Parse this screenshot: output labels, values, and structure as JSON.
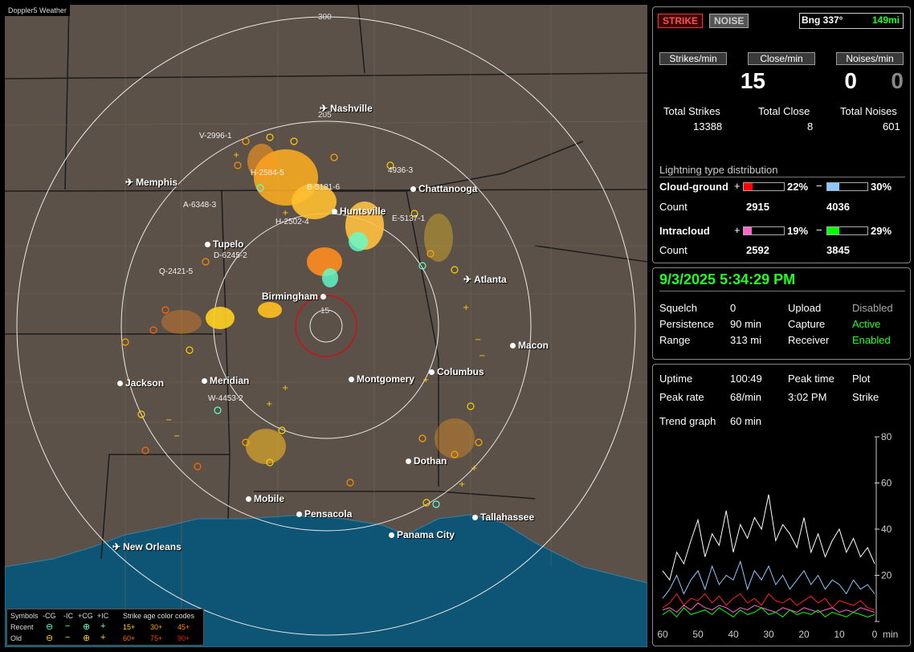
{
  "app": {
    "title": "Doppler5 Weather"
  },
  "map": {
    "range_labels": [
      "300",
      "205",
      "15"
    ],
    "cities": [
      {
        "name": "Nashville",
        "type": "airport"
      },
      {
        "name": "Memphis",
        "type": "airport"
      },
      {
        "name": "Chattanooga",
        "type": "city"
      },
      {
        "name": "Huntsville",
        "type": "city"
      },
      {
        "name": "Tupelo",
        "type": "city"
      },
      {
        "name": "Atlanta",
        "type": "airport"
      },
      {
        "name": "Birmingham",
        "type": "city"
      },
      {
        "name": "Macon",
        "type": "city"
      },
      {
        "name": "Jackson",
        "type": "city"
      },
      {
        "name": "Meridian",
        "type": "city"
      },
      {
        "name": "Montgomery",
        "type": "city"
      },
      {
        "name": "Columbus",
        "type": "city"
      },
      {
        "name": "Dothan",
        "type": "city"
      },
      {
        "name": "Mobile",
        "type": "city"
      },
      {
        "name": "Pensacola",
        "type": "city"
      },
      {
        "name": "Tallahassee",
        "type": "city"
      },
      {
        "name": "Panama City",
        "type": "city"
      },
      {
        "name": "New Orleans",
        "type": "airport"
      }
    ],
    "storm_labels": [
      "V-2996-1",
      "H-2584-5",
      "B-5181-6",
      "4936-3",
      "A-6348-3",
      "H-2502-4",
      "E-5137-1",
      "D-6245-2",
      "Q-2421-5",
      "W-4453-2"
    ]
  },
  "legend": {
    "symbols_label": "Symbols",
    "headers": [
      "-CG",
      "-IC",
      "+CG",
      "+IC"
    ],
    "recent_label": "Recent",
    "old_label": "Old",
    "age_title": "Strike age color codes",
    "recent_ages": [
      "15+",
      "30+",
      "45+"
    ],
    "old_ages": [
      "60+",
      "75+",
      "90+"
    ],
    "age_colors": [
      "#ffd700",
      "#ffa500",
      "#ff8c00",
      "#ff6a00",
      "#ff4500",
      "#e02000"
    ]
  },
  "status": {
    "strike_label": "STRIKE",
    "noise_label": "NOISE",
    "bearing": "Bng 337°",
    "distance": "149mi",
    "strikes_per_min_label": "Strikes/min",
    "close_per_min_label": "Close/min",
    "noises_per_min_label": "Noises/min",
    "strikes_per_min": "15",
    "close_per_min": "0",
    "noises_per_min": "0",
    "total_strikes_label": "Total Strikes",
    "total_close_label": "Total Close",
    "total_noises_label": "Total Noises",
    "total_strikes": "13388",
    "total_close": "8",
    "total_noises": "601",
    "dist_title": "Lightning type distribution",
    "cg_label": "Cloud-ground",
    "ic_label": "Intracloud",
    "count_label": "Count",
    "plus": "+",
    "minus": "−",
    "cg_pos_pct": "22%",
    "cg_neg_pct": "30%",
    "cg_pos_count": "2915",
    "cg_neg_count": "4036",
    "ic_pos_pct": "19%",
    "ic_neg_pct": "29%",
    "ic_pos_count": "2592",
    "ic_neg_count": "3845",
    "bar_levels": {
      "cg_pos": 0.22,
      "cg_neg": 0.3,
      "ic_pos": 0.19,
      "ic_neg": 0.29
    },
    "bar_colors": {
      "cg_pos": "#ff0000",
      "cg_neg": "#8ec8ff",
      "ic_pos": "#ff66cc",
      "ic_neg": "#00ff00"
    }
  },
  "settings": {
    "datetime": "9/3/2025 5:34:29 PM",
    "squelch_label": "Squelch",
    "squelch": "0",
    "persistence_label": "Persistence",
    "persistence": "90 min",
    "range_label": "Range",
    "range": "313 mi",
    "upload_label": "Upload",
    "upload": "Disabled",
    "capture_label": "Capture",
    "capture": "Active",
    "receiver_label": "Receiver",
    "receiver": "Enabled"
  },
  "trend": {
    "uptime_label": "Uptime",
    "uptime": "100:49",
    "peak_time_label": "Peak time",
    "plot_label": "Plot",
    "peak_rate_label": "Peak rate",
    "peak_rate": "68/min",
    "peak_time": "3:02 PM",
    "plot": "Strike",
    "trend_graph_label": "Trend graph",
    "trend_graph": "60 min",
    "y_ticks": [
      "80",
      "60",
      "40",
      "20",
      "0"
    ],
    "x_ticks": [
      "60",
      "50",
      "40",
      "30",
      "20",
      "10",
      "0"
    ],
    "x_unit": "min"
  },
  "chart_data": {
    "type": "line",
    "xlabel": "min",
    "xlim": [
      60,
      0
    ],
    "ylim": [
      0,
      80
    ],
    "x": [
      60,
      58,
      56,
      54,
      52,
      50,
      48,
      46,
      44,
      42,
      40,
      38,
      36,
      34,
      32,
      30,
      28,
      26,
      24,
      22,
      20,
      18,
      16,
      14,
      12,
      10,
      8,
      6,
      4,
      2,
      0
    ],
    "series": [
      {
        "color": "#ffffff",
        "values": [
          22,
          18,
          30,
          25,
          35,
          44,
          28,
          38,
          33,
          48,
          30,
          42,
          36,
          45,
          40,
          55,
          35,
          42,
          38,
          32,
          45,
          30,
          38,
          28,
          35,
          40,
          30,
          36,
          28,
          32,
          25
        ]
      },
      {
        "color": "#8ec8ff",
        "values": [
          10,
          14,
          20,
          12,
          18,
          22,
          14,
          24,
          16,
          20,
          18,
          26,
          14,
          22,
          18,
          24,
          16,
          20,
          14,
          18,
          22,
          16,
          20,
          14,
          18,
          16,
          12,
          18,
          14,
          16,
          12
        ]
      },
      {
        "color": "#ff2020",
        "values": [
          6,
          8,
          12,
          7,
          10,
          9,
          12,
          8,
          11,
          7,
          10,
          12,
          8,
          10,
          7,
          12,
          9,
          8,
          10,
          7,
          9,
          11,
          8,
          10,
          6,
          9,
          8,
          7,
          9,
          6,
          5
        ]
      },
      {
        "color": "#ff66cc",
        "values": [
          5,
          6,
          4,
          7,
          5,
          8,
          6,
          5,
          7,
          6,
          4,
          6,
          5,
          7,
          6,
          5,
          4,
          6,
          5,
          4,
          6,
          5,
          4,
          5,
          6,
          4,
          5,
          4,
          6,
          5,
          4
        ]
      },
      {
        "color": "#00ff00",
        "values": [
          3,
          5,
          2,
          6,
          3,
          4,
          5,
          3,
          6,
          4,
          2,
          5,
          3,
          4,
          6,
          3,
          4,
          2,
          5,
          3,
          4,
          3,
          5,
          2,
          4,
          3,
          2,
          4,
          3,
          2,
          3
        ]
      }
    ]
  }
}
